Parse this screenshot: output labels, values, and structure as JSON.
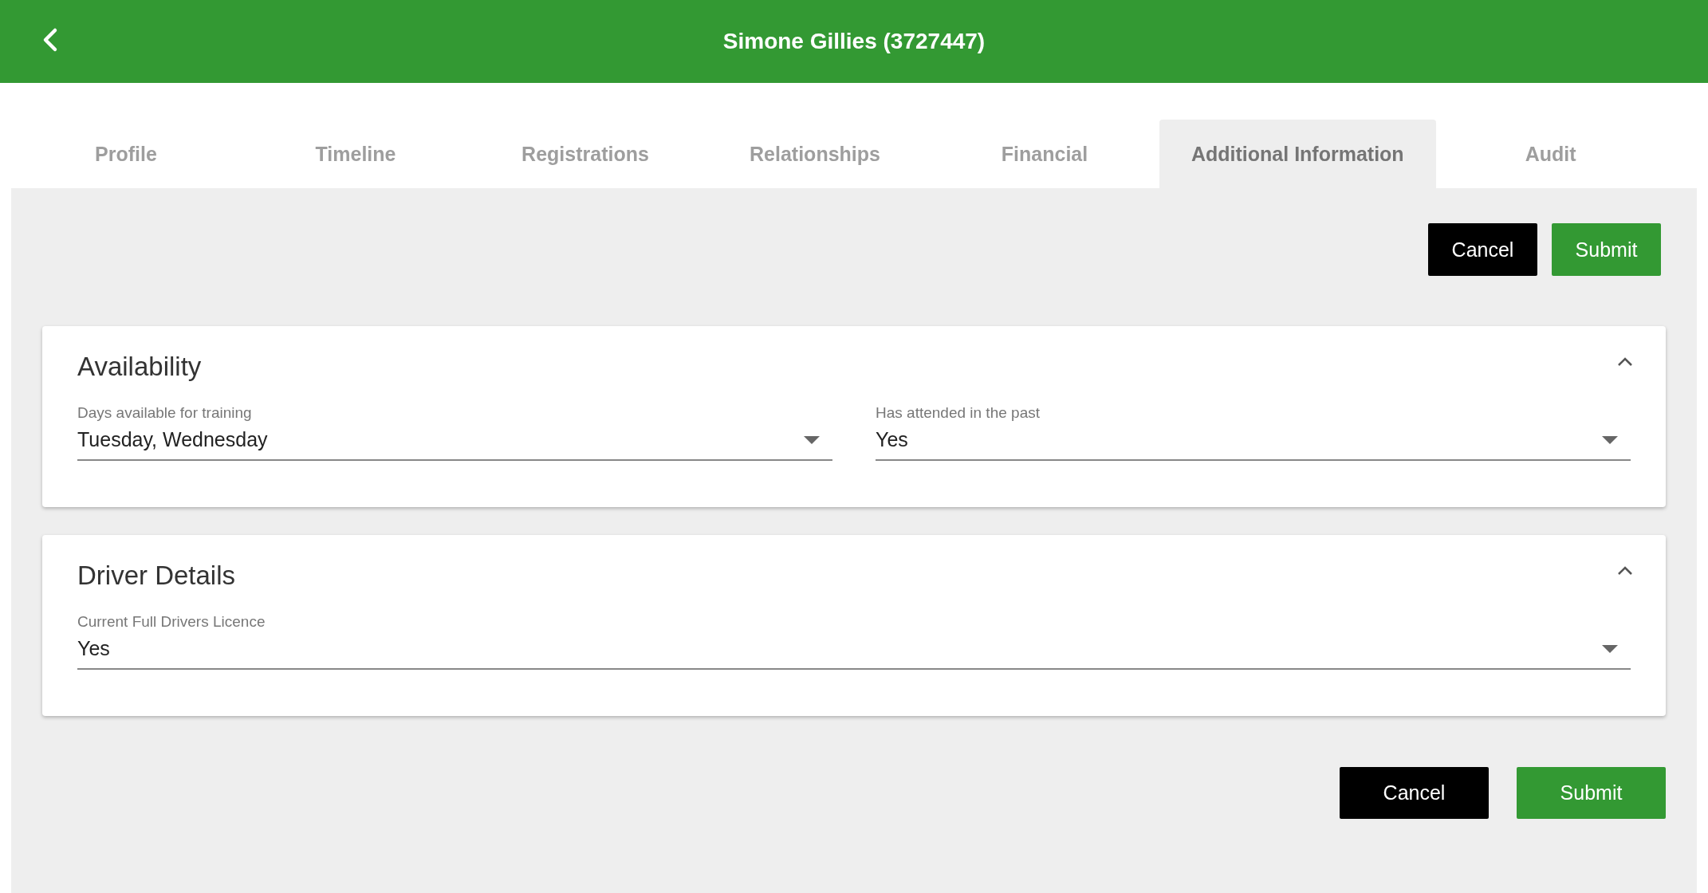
{
  "header": {
    "title": "Simone Gillies (3727447)"
  },
  "tabs": [
    {
      "label": "Profile",
      "selected": false
    },
    {
      "label": "Timeline",
      "selected": false
    },
    {
      "label": "Registrations",
      "selected": false
    },
    {
      "label": "Relationships",
      "selected": false
    },
    {
      "label": "Financial",
      "selected": false
    },
    {
      "label": "Additional Information",
      "selected": true
    },
    {
      "label": "Audit",
      "selected": false
    }
  ],
  "top_actions": [
    {
      "label": "Cancel",
      "kind": "cancel"
    },
    {
      "label": "Submit",
      "kind": "submit"
    }
  ],
  "sections": [
    {
      "title": "Availability",
      "expanded": true,
      "fields": [
        {
          "label": "Days available for training",
          "value": "Tuesday, Wednesday"
        },
        {
          "label": "Has attended in the past",
          "value": "Yes"
        }
      ]
    },
    {
      "title": "Driver Details",
      "expanded": true,
      "fields": [
        {
          "label": "Current Full Drivers Licence",
          "value": "Yes"
        }
      ]
    }
  ],
  "bottom_actions": [
    {
      "label": "Cancel",
      "kind": "cancel"
    },
    {
      "label": "Submit",
      "kind": "submit"
    }
  ]
}
